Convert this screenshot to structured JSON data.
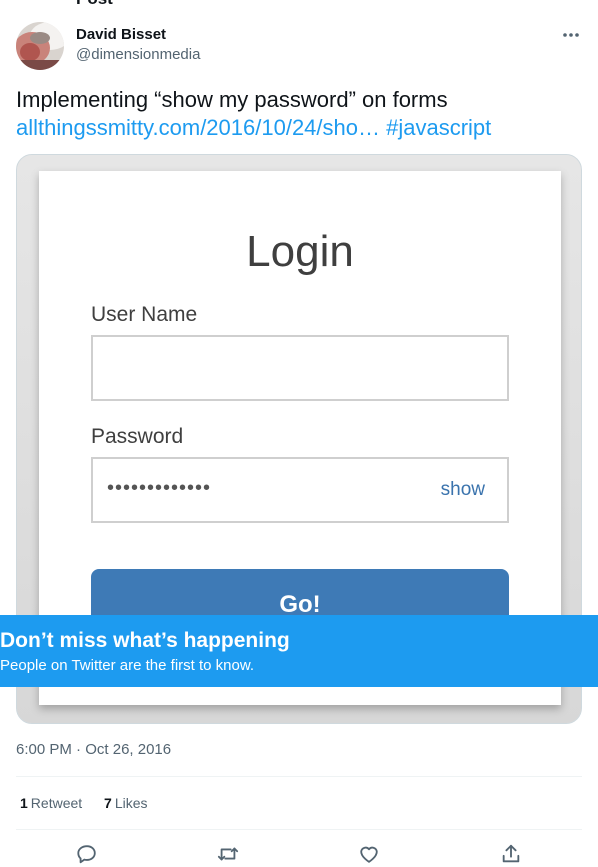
{
  "cut_header": {
    "text": "Post"
  },
  "tweet": {
    "display_name": "David Bisset",
    "handle": "@dimensionmedia",
    "text": "Implementing “show my password” on forms",
    "link_text": "allthingssmitty.com/2016/10/24/sho…",
    "hashtag": "#javascript",
    "timestamp_time": "6:00 PM",
    "timestamp_sep": " · ",
    "timestamp_date": "Oct 26, 2016"
  },
  "media": {
    "login_title": "Login",
    "username_label": "User Name",
    "password_label": "Password",
    "password_dots": "•••••••••••••",
    "show_label": "show",
    "go_label": "Go!"
  },
  "banner": {
    "title": "Don’t miss what’s happening",
    "subtitle": "People on Twitter are the first to know."
  },
  "stats": {
    "retweet_count": "1",
    "retweet_label": "Retweet",
    "like_count": "7",
    "like_label": "Likes"
  },
  "icons": {
    "more": "more-icon",
    "reply": "reply-icon",
    "retweet": "retweet-icon",
    "like": "heart-icon",
    "share": "share-icon"
  },
  "colors": {
    "accent": "#1d9bf0",
    "text": "#0f1419",
    "muted": "#536471"
  }
}
